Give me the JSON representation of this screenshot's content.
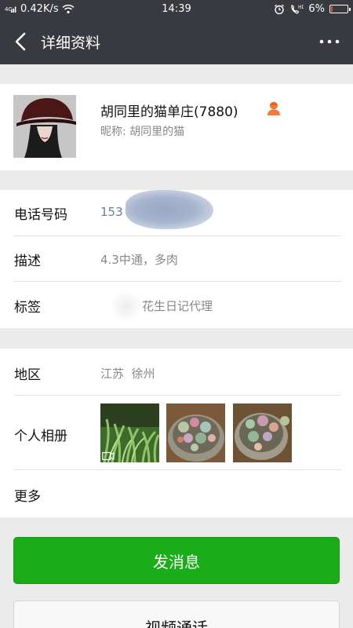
{
  "status_bar": {
    "network_speed": "0.42K/s",
    "time": "14:39",
    "battery": "6%",
    "battery_level_percent": 6
  },
  "nav": {
    "title": "详细资料",
    "back_icon": "chevron-left-icon",
    "more_icon": "more-dots-icon"
  },
  "profile": {
    "name": "胡同里的猫单庄(7880)",
    "nickname": "昵称: 胡同里的猫",
    "gender_icon": "female-user-icon",
    "gender_color": "#f37b3e"
  },
  "contact": {
    "phone_label": "电话号码",
    "phone_value": "153",
    "description_label": "描述",
    "description_value": "4.3中通，多肉",
    "tags_label": "标签",
    "tags_value": "花生日记代理"
  },
  "details": {
    "region_label": "地区",
    "region_value": "江苏  徐州",
    "album_label": "个人相册",
    "more_label": "更多"
  },
  "actions": {
    "send_message": "发消息",
    "video_call": "视频通话"
  },
  "colors": {
    "header_bg": "#393a3f",
    "primary_green": "#1aad19"
  }
}
